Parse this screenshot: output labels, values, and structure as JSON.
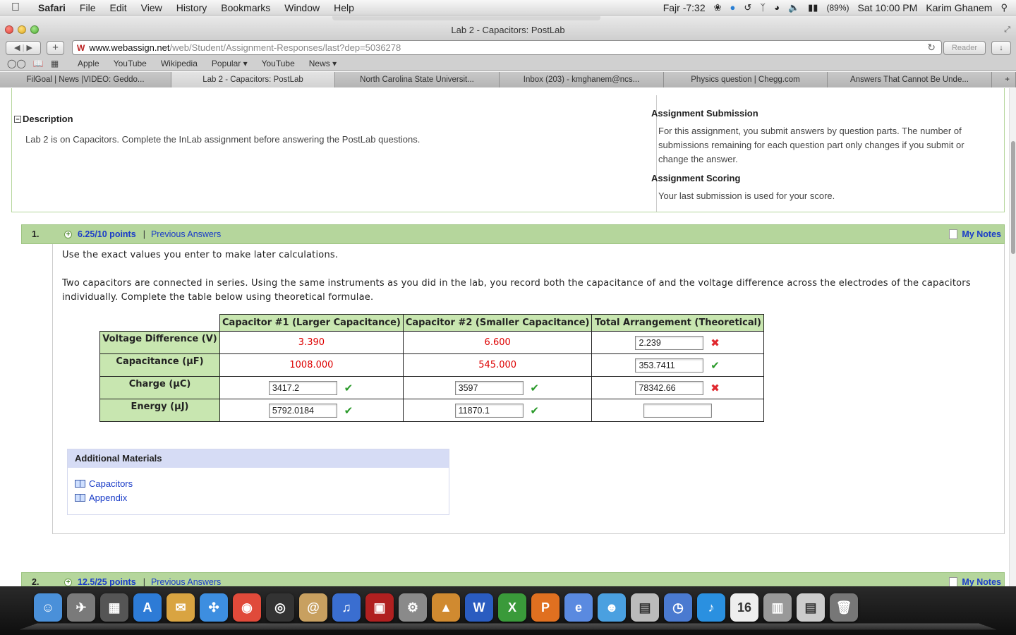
{
  "menubar": {
    "app": "Safari",
    "items": [
      "File",
      "Edit",
      "View",
      "History",
      "Bookmarks",
      "Window",
      "Help"
    ],
    "prayer": "Fajr -7:32",
    "battery": "(89%)",
    "clock": "Sat 10:00 PM",
    "user": "Karim Ghanem"
  },
  "window": {
    "title": "Lab 2 - Capacitors: PostLab",
    "url_host": "www.webassign.net",
    "url_path": "/web/Student/Assignment-Responses/last?dep=5036278",
    "reader_label": "Reader"
  },
  "bookmarks": [
    "Apple",
    "YouTube",
    "Wikipedia",
    "Popular ▾",
    "YouTube",
    "News ▾"
  ],
  "tabs": [
    "FilGoal | News |VIDEO: Geddo...",
    "Lab 2 - Capacitors: PostLab",
    "North Carolina State Universit...",
    "Inbox (203) - kmghanem@ncs...",
    "Physics question | Chegg.com",
    "Answers That Cannot Be Unde..."
  ],
  "description": {
    "title": "Description",
    "text": "Lab 2 is on Capacitors. Complete the InLab assignment before answering the PostLab questions."
  },
  "submission": {
    "title": "Assignment Submission",
    "text": "For this assignment, you submit answers by question parts. The number of submissions remaining for each question part only changes if you submit or change the answer.",
    "scoring_title": "Assignment Scoring",
    "scoring_text": "Your last submission is used for your score."
  },
  "q1": {
    "number": "1.",
    "points": "6.25/10 points",
    "prev": "Previous Answers",
    "notes": "My Notes",
    "line1": "Use the exact values you enter to make later calculations.",
    "line2": "Two capacitors are connected in series. Using the same instruments as you did in the lab, you record both the capacitance of and the voltage difference across the electrodes of the capacitors individually. Complete the table below using theoretical formulae."
  },
  "table": {
    "headers": [
      "Capacitor #1 (Larger Capacitance)",
      "Capacitor #2 (Smaller Capacitance)",
      "Total Arrangement (Theoretical)"
    ],
    "rows": [
      {
        "label": "Voltage Difference (V)",
        "c1": "3.390",
        "c2": "6.600",
        "total": "2.239",
        "total_status": "wrong"
      },
      {
        "label": "Capacitance (μF)",
        "c1": "1008.000",
        "c2": "545.000",
        "total": "353.7411",
        "total_status": "correct"
      },
      {
        "label": "Charge (μC)",
        "c1": "3417.2",
        "c1_status": "correct",
        "c2": "3597",
        "c2_status": "correct",
        "total": "78342.66",
        "total_status": "wrong"
      },
      {
        "label": "Energy (μJ)",
        "c1": "5792.0184",
        "c1_status": "correct",
        "c2": "11870.1",
        "c2_status": "correct",
        "total": ""
      }
    ]
  },
  "materials": {
    "title": "Additional Materials",
    "links": [
      "Capacitors",
      "Appendix"
    ]
  },
  "q2": {
    "number": "2.",
    "points": "12.5/25 points",
    "prev": "Previous Answers",
    "notes": "My Notes"
  },
  "dock": [
    "Finder",
    "Launchpad",
    "Dashboard",
    "App Store",
    "Mail",
    "Safari",
    "Chrome",
    "FaceTime",
    "Contacts",
    "iTunes",
    "Photo Booth",
    "System Preferences",
    "iPhoto",
    "Word",
    "Excel",
    "PowerPoint",
    "Entourage",
    "Messenger",
    "Preview",
    "Time Machine",
    "Twitter",
    "iCal",
    "Downloads",
    "Documents",
    "Trash"
  ],
  "colors": {
    "link": "#1a3cc8",
    "question_bar": "#b5d69c",
    "given_value": "#dd0000"
  }
}
